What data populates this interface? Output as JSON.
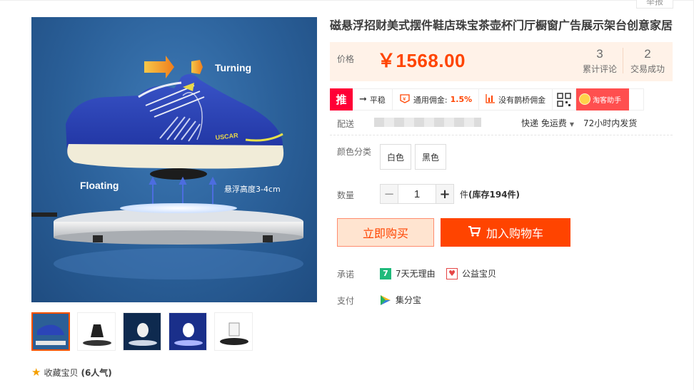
{
  "report": "举报",
  "product": {
    "title": "磁悬浮招财美式摆件鞋店珠宝茶壶杯门厅橱窗广告展示架台创意家居",
    "price_label": "价格",
    "price": "￥1568.00",
    "reviews_count": "3",
    "reviews_label": "累计评论",
    "sales_count": "2",
    "sales_label": "交易成功"
  },
  "image_overlay": {
    "turning": "Turning",
    "floating": "Floating",
    "height_note": "悬浮高度3-4cm",
    "shoe_brand": "USCAR"
  },
  "promo": {
    "tag": "推",
    "items": [
      {
        "icon": "arrow-right-icon",
        "label": "平稳",
        "extra": ""
      },
      {
        "icon": "coin-badge-icon",
        "label": "通用佣金:",
        "extra": "1.5%"
      },
      {
        "icon": "bar-chart-icon",
        "label": "没有鹊桥佣金",
        "extra": ""
      }
    ],
    "helper": "淘客助手"
  },
  "shipping": {
    "label": "配送",
    "method": "快递 免运费",
    "time": "72小时内发货"
  },
  "options": {
    "color_label": "颜色分类",
    "colors": [
      "白色",
      "黑色"
    ],
    "qty_label": "数量",
    "qty_value": "1",
    "minus": "−",
    "plus": "+",
    "stock_prefix": "件",
    "stock": "(库存194件)"
  },
  "actions": {
    "buy_now": "立即购买",
    "add_cart": "加入购物车"
  },
  "services": {
    "promise_label": "承诺",
    "promise_items": [
      "7天无理由",
      "公益宝贝"
    ],
    "seven_day_badge": "7",
    "pay_label": "支付",
    "pay_items": [
      "集分宝"
    ]
  },
  "favorite": {
    "label": "收藏宝贝",
    "count": "(6人气)"
  },
  "colors": {
    "accent": "#ff4400",
    "price_bg": "#fff2e8",
    "promo_red": "#ff0036"
  }
}
